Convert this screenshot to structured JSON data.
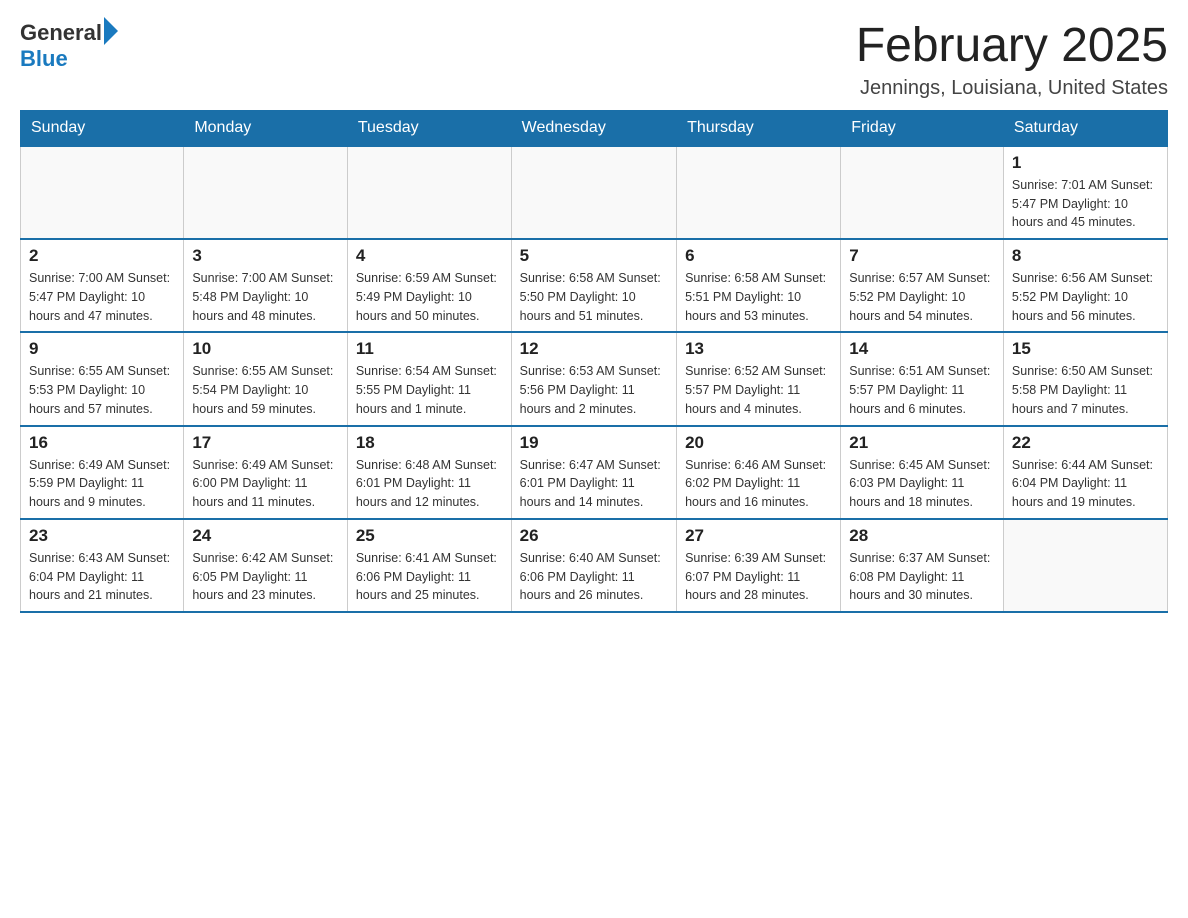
{
  "header": {
    "logo": {
      "general": "General",
      "blue": "Blue"
    },
    "title": "February 2025",
    "location": "Jennings, Louisiana, United States"
  },
  "days_of_week": [
    "Sunday",
    "Monday",
    "Tuesday",
    "Wednesday",
    "Thursday",
    "Friday",
    "Saturday"
  ],
  "weeks": [
    [
      {
        "day": "",
        "info": ""
      },
      {
        "day": "",
        "info": ""
      },
      {
        "day": "",
        "info": ""
      },
      {
        "day": "",
        "info": ""
      },
      {
        "day": "",
        "info": ""
      },
      {
        "day": "",
        "info": ""
      },
      {
        "day": "1",
        "info": "Sunrise: 7:01 AM\nSunset: 5:47 PM\nDaylight: 10 hours\nand 45 minutes."
      }
    ],
    [
      {
        "day": "2",
        "info": "Sunrise: 7:00 AM\nSunset: 5:47 PM\nDaylight: 10 hours\nand 47 minutes."
      },
      {
        "day": "3",
        "info": "Sunrise: 7:00 AM\nSunset: 5:48 PM\nDaylight: 10 hours\nand 48 minutes."
      },
      {
        "day": "4",
        "info": "Sunrise: 6:59 AM\nSunset: 5:49 PM\nDaylight: 10 hours\nand 50 minutes."
      },
      {
        "day": "5",
        "info": "Sunrise: 6:58 AM\nSunset: 5:50 PM\nDaylight: 10 hours\nand 51 minutes."
      },
      {
        "day": "6",
        "info": "Sunrise: 6:58 AM\nSunset: 5:51 PM\nDaylight: 10 hours\nand 53 minutes."
      },
      {
        "day": "7",
        "info": "Sunrise: 6:57 AM\nSunset: 5:52 PM\nDaylight: 10 hours\nand 54 minutes."
      },
      {
        "day": "8",
        "info": "Sunrise: 6:56 AM\nSunset: 5:52 PM\nDaylight: 10 hours\nand 56 minutes."
      }
    ],
    [
      {
        "day": "9",
        "info": "Sunrise: 6:55 AM\nSunset: 5:53 PM\nDaylight: 10 hours\nand 57 minutes."
      },
      {
        "day": "10",
        "info": "Sunrise: 6:55 AM\nSunset: 5:54 PM\nDaylight: 10 hours\nand 59 minutes."
      },
      {
        "day": "11",
        "info": "Sunrise: 6:54 AM\nSunset: 5:55 PM\nDaylight: 11 hours\nand 1 minute."
      },
      {
        "day": "12",
        "info": "Sunrise: 6:53 AM\nSunset: 5:56 PM\nDaylight: 11 hours\nand 2 minutes."
      },
      {
        "day": "13",
        "info": "Sunrise: 6:52 AM\nSunset: 5:57 PM\nDaylight: 11 hours\nand 4 minutes."
      },
      {
        "day": "14",
        "info": "Sunrise: 6:51 AM\nSunset: 5:57 PM\nDaylight: 11 hours\nand 6 minutes."
      },
      {
        "day": "15",
        "info": "Sunrise: 6:50 AM\nSunset: 5:58 PM\nDaylight: 11 hours\nand 7 minutes."
      }
    ],
    [
      {
        "day": "16",
        "info": "Sunrise: 6:49 AM\nSunset: 5:59 PM\nDaylight: 11 hours\nand 9 minutes."
      },
      {
        "day": "17",
        "info": "Sunrise: 6:49 AM\nSunset: 6:00 PM\nDaylight: 11 hours\nand 11 minutes."
      },
      {
        "day": "18",
        "info": "Sunrise: 6:48 AM\nSunset: 6:01 PM\nDaylight: 11 hours\nand 12 minutes."
      },
      {
        "day": "19",
        "info": "Sunrise: 6:47 AM\nSunset: 6:01 PM\nDaylight: 11 hours\nand 14 minutes."
      },
      {
        "day": "20",
        "info": "Sunrise: 6:46 AM\nSunset: 6:02 PM\nDaylight: 11 hours\nand 16 minutes."
      },
      {
        "day": "21",
        "info": "Sunrise: 6:45 AM\nSunset: 6:03 PM\nDaylight: 11 hours\nand 18 minutes."
      },
      {
        "day": "22",
        "info": "Sunrise: 6:44 AM\nSunset: 6:04 PM\nDaylight: 11 hours\nand 19 minutes."
      }
    ],
    [
      {
        "day": "23",
        "info": "Sunrise: 6:43 AM\nSunset: 6:04 PM\nDaylight: 11 hours\nand 21 minutes."
      },
      {
        "day": "24",
        "info": "Sunrise: 6:42 AM\nSunset: 6:05 PM\nDaylight: 11 hours\nand 23 minutes."
      },
      {
        "day": "25",
        "info": "Sunrise: 6:41 AM\nSunset: 6:06 PM\nDaylight: 11 hours\nand 25 minutes."
      },
      {
        "day": "26",
        "info": "Sunrise: 6:40 AM\nSunset: 6:06 PM\nDaylight: 11 hours\nand 26 minutes."
      },
      {
        "day": "27",
        "info": "Sunrise: 6:39 AM\nSunset: 6:07 PM\nDaylight: 11 hours\nand 28 minutes."
      },
      {
        "day": "28",
        "info": "Sunrise: 6:37 AM\nSunset: 6:08 PM\nDaylight: 11 hours\nand 30 minutes."
      },
      {
        "day": "",
        "info": ""
      }
    ]
  ]
}
